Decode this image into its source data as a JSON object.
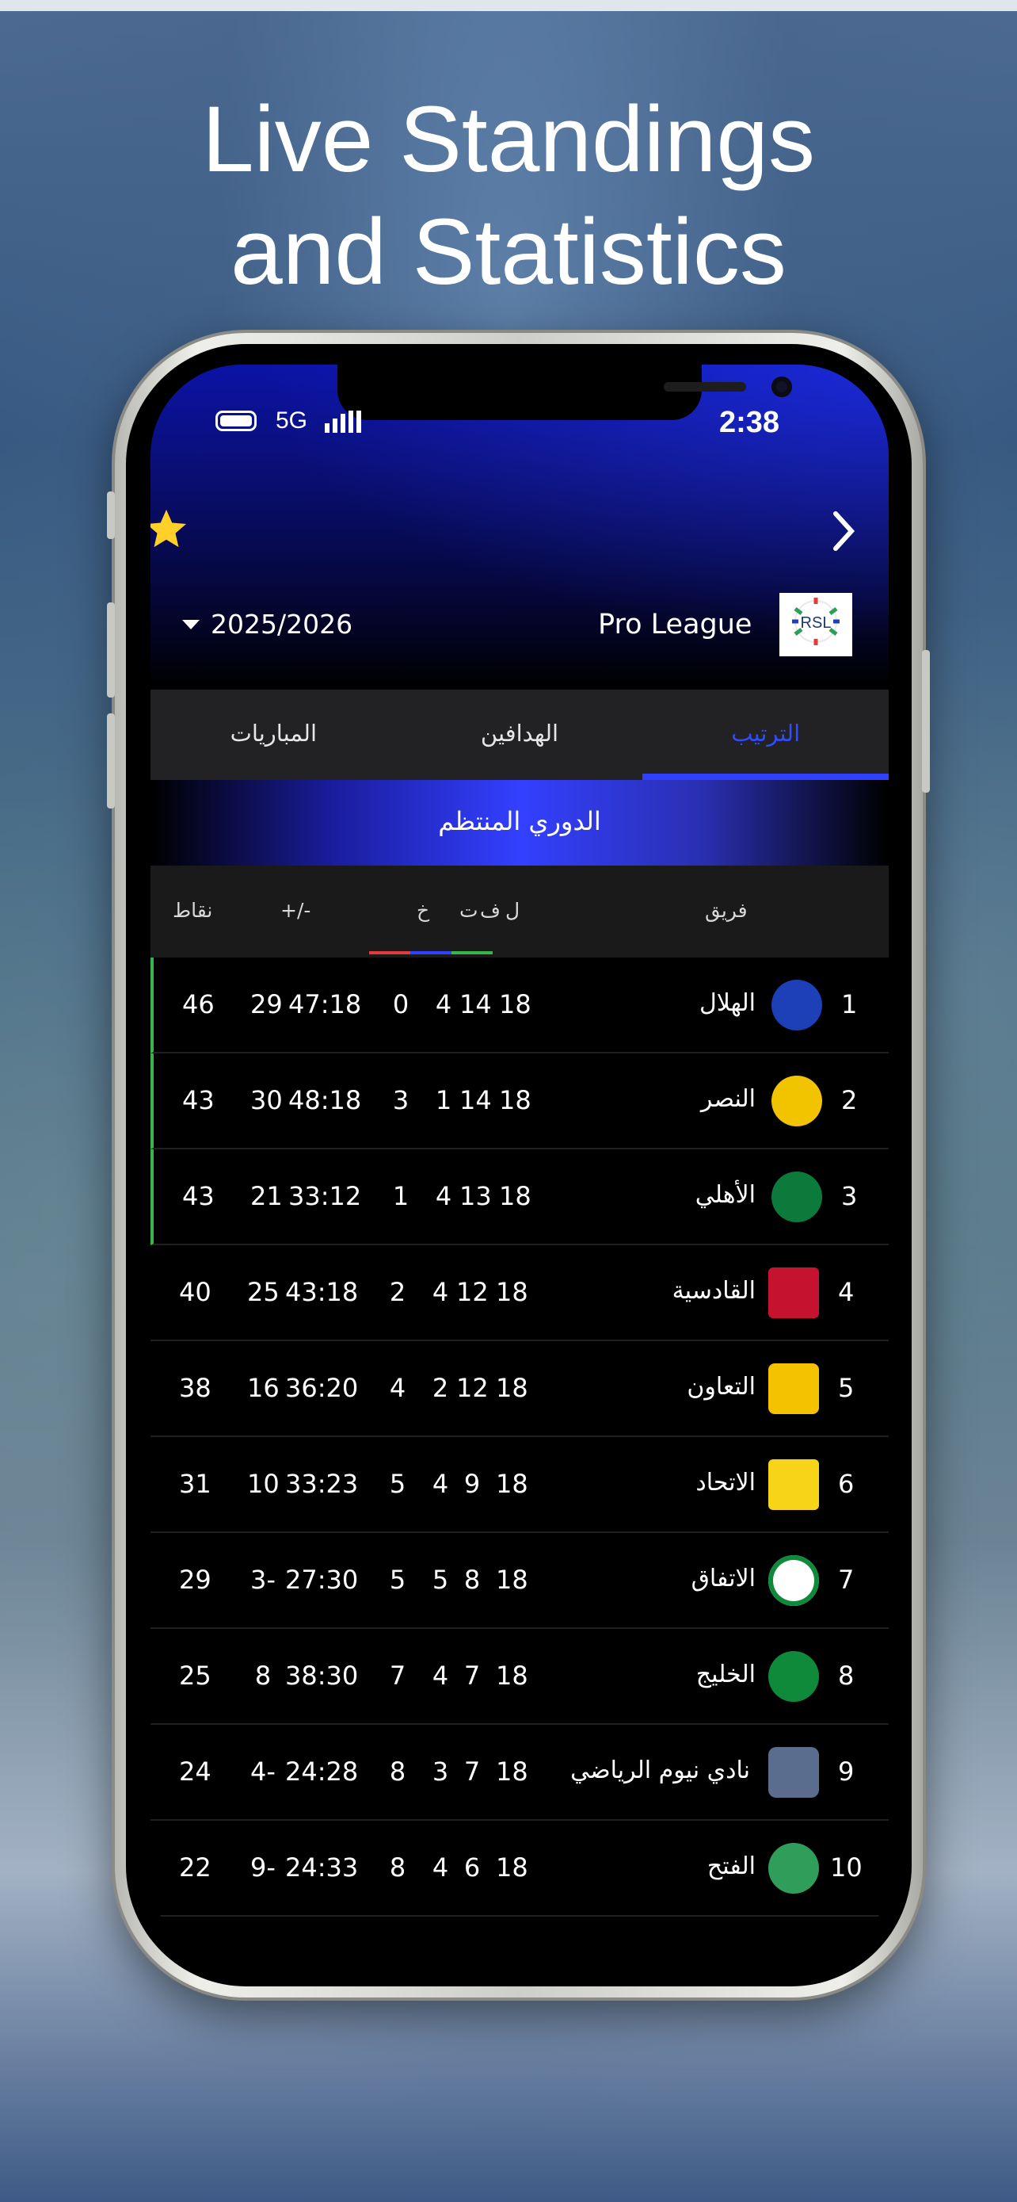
{
  "hero": {
    "line1": "Live Standings",
    "line2": "and Statistics"
  },
  "status": {
    "network": "5G",
    "time": "2:38"
  },
  "header": {
    "season": "2025/2026",
    "league": "Pro League",
    "logo_text": "RSL"
  },
  "tabs": [
    {
      "label": "الترتيب",
      "active": true
    },
    {
      "label": "الهدافين",
      "active": false
    },
    {
      "label": "المباريات",
      "active": false
    }
  ],
  "section_title": "الدوري المنتظم",
  "columns": {
    "team": "فريق",
    "played": "ل",
    "won": "ف",
    "drawn": "ت",
    "lost": "خ",
    "goals": "+/-",
    "points": "نقاط"
  },
  "colors": {
    "accent": "#2f41ff",
    "qualify": "#38b547",
    "lost": "#e23b3b",
    "drawn": "#2f41ff",
    "won": "#38b547"
  },
  "standings": [
    {
      "pos": "1",
      "team": "الهلال",
      "played": "18",
      "won": "14",
      "drawn": "4",
      "lost": "0",
      "goals": "47:18",
      "diff": "29",
      "points": "46",
      "logo_color": "#1d3fb8",
      "qualify": true
    },
    {
      "pos": "2",
      "team": "النصر",
      "played": "18",
      "won": "14",
      "drawn": "1",
      "lost": "3",
      "goals": "48:18",
      "diff": "30",
      "points": "43",
      "logo_color": "#f2c400",
      "qualify": true
    },
    {
      "pos": "3",
      "team": "الأهلي",
      "played": "18",
      "won": "13",
      "drawn": "4",
      "lost": "1",
      "goals": "33:12",
      "diff": "21",
      "points": "43",
      "logo_color": "#0b7a3b",
      "qualify": true
    },
    {
      "pos": "4",
      "team": "القادسية",
      "played": "18",
      "won": "12",
      "drawn": "4",
      "lost": "2",
      "goals": "43:18",
      "diff": "25",
      "points": "40",
      "logo_color": "#c4122f",
      "qualify": false
    },
    {
      "pos": "5",
      "team": "التعاون",
      "played": "18",
      "won": "12",
      "drawn": "2",
      "lost": "4",
      "goals": "36:20",
      "diff": "16",
      "points": "38",
      "logo_color": "#f5c200",
      "qualify": false
    },
    {
      "pos": "6",
      "team": "الاتحاد",
      "played": "18",
      "won": "9",
      "drawn": "4",
      "lost": "5",
      "goals": "33:23",
      "diff": "10",
      "points": "31",
      "logo_color": "#f7d417",
      "qualify": false
    },
    {
      "pos": "7",
      "team": "الاتفاق",
      "played": "18",
      "won": "8",
      "drawn": "5",
      "lost": "5",
      "goals": "27:30",
      "diff": "3-",
      "points": "29",
      "logo_color": "#ffffff",
      "qualify": false
    },
    {
      "pos": "8",
      "team": "الخليج",
      "played": "18",
      "won": "7",
      "drawn": "4",
      "lost": "7",
      "goals": "38:30",
      "diff": "8",
      "points": "25",
      "logo_color": "#0f8a3a",
      "qualify": false
    },
    {
      "pos": "9",
      "team": "نادي نيوم الرياضي",
      "played": "18",
      "won": "7",
      "drawn": "3",
      "lost": "8",
      "goals": "24:28",
      "diff": "4-",
      "points": "24",
      "logo_color": "#5a6d8f",
      "qualify": false
    },
    {
      "pos": "10",
      "team": "الفتح",
      "played": "18",
      "won": "6",
      "drawn": "4",
      "lost": "8",
      "goals": "24:33",
      "diff": "9-",
      "points": "22",
      "logo_color": "#2e9e5a",
      "qualify": false
    }
  ]
}
